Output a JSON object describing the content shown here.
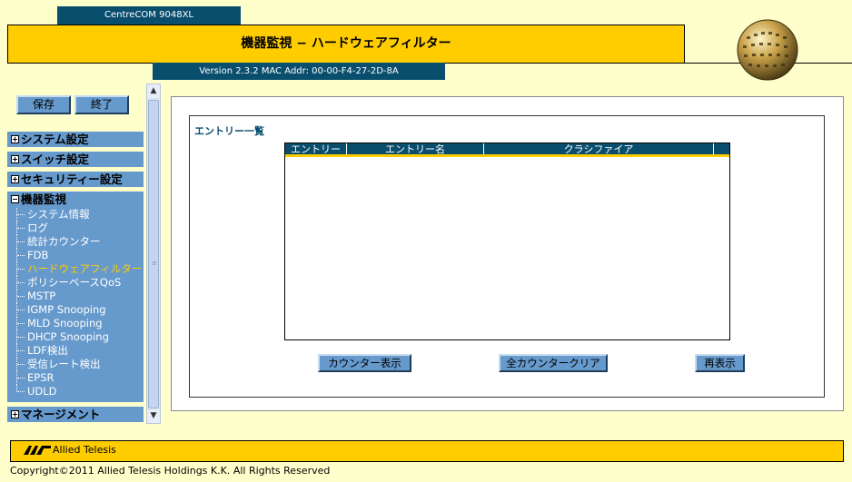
{
  "header": {
    "product": "CentreCOM 9048XL",
    "title": "機器監視 − ハードウェアフィルター",
    "version": "Version 2.3.2 MAC Addr: 00-00-F4-27-2D-8A"
  },
  "toolbar": {
    "save_label": "保存",
    "exit_label": "終了"
  },
  "nav": {
    "system": "システム設定",
    "switch": "スイッチ設定",
    "security": "セキュリティー設定",
    "monitor": "機器監視",
    "monitor_items": [
      "システム情報",
      "ログ",
      "統計カウンター",
      "FDB",
      "ハードウェアフィルター",
      "ポリシーベースQoS",
      "MSTP",
      "IGMP Snooping",
      "MLD Snooping",
      "DHCP Snooping",
      "LDF検出",
      "受信レート検出",
      "EPSR",
      "UDLD"
    ],
    "management": "マネージメント"
  },
  "main": {
    "section_title": "エントリー一覧",
    "table": {
      "columns": [
        "エントリー",
        "エントリー名",
        "クラシファイア",
        ""
      ],
      "rows": []
    },
    "buttons": {
      "counter": "カウンター表示",
      "clear": "全カウンタークリア",
      "refresh": "再表示"
    }
  },
  "footer": {
    "logo": "Allied Telesis",
    "copyright": "Copyright©2011 Allied Telesis Holdings K.K. All Rights Reserved"
  },
  "colors": {
    "background": "#FFFFCC",
    "accent_yellow": "#FFCC00",
    "dark_teal": "#0A4E6E",
    "nav_blue": "#6699CC",
    "active_item": "#FFCC00"
  },
  "icons": [
    "globe-logo-icon",
    "plus-box-icon",
    "minus-box-icon",
    "scroll-up-icon",
    "scroll-down-icon",
    "allied-telesis-logo-icon"
  ]
}
